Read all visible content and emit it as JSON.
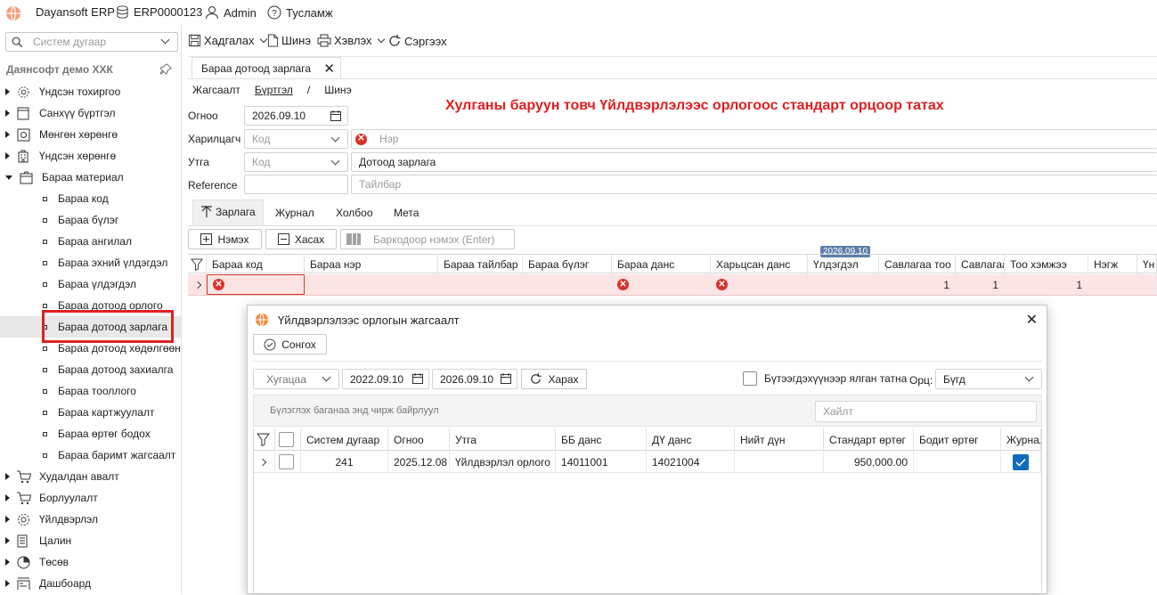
{
  "topbar": {
    "app_name": "Dayansoft ERP",
    "erp_code": "ERP0000123",
    "user": "Admin",
    "help": "Тусламж"
  },
  "toolbar": {
    "save": "Хадгалах",
    "new": "Шинэ",
    "print": "Хэвлэх",
    "refresh": "Сэргээх"
  },
  "sidebar": {
    "search_placeholder": "Систем дугаар",
    "company": "Даянсофт демо ХХК",
    "items": [
      {
        "label": "Үндсэн тохиргоо",
        "icon": "gear-icon"
      },
      {
        "label": "Санхүү бүртгэл",
        "icon": "ledger-icon"
      },
      {
        "label": "Мөнгөн хөрөнгө",
        "icon": "cash-icon"
      },
      {
        "label": "Үндсэн хөрөнгө",
        "icon": "building-icon"
      },
      {
        "label": "Бараа материал",
        "icon": "box-icon"
      }
    ],
    "sub_items": [
      "Бараа код",
      "Бараа бүлэг",
      "Бараа ангилал",
      "Бараа эхний үлдэгдэл",
      "Бараа үлдэгдэл",
      "Бараа дотоод орлого",
      "Бараа дотоод зарлага",
      "Бараа дотоод хөдөлгөөн",
      "Бараа дотоод захиалга",
      "Бараа тооллого",
      "Бараа картжуулалт",
      "Бараа өртөг бодох",
      "Бараа баримт жагсаалт"
    ],
    "bottom_items": [
      {
        "label": "Худалдан авалт",
        "icon": "cart-icon"
      },
      {
        "label": "Борлуулалт",
        "icon": "sales-icon"
      },
      {
        "label": "Үйлдвэрлэл",
        "icon": "factory-icon"
      },
      {
        "label": "Цалин",
        "icon": "payroll-icon"
      },
      {
        "label": "Төсөв",
        "icon": "pie-icon"
      },
      {
        "label": "Дашбоард",
        "icon": "dashboard-icon"
      }
    ]
  },
  "document_tab": {
    "label": "Бараа дотоод зарлага"
  },
  "breadcrumb": {
    "list": "Жагсаалт",
    "register": "Бүртгэл",
    "sep": "/",
    "new": "Шинэ"
  },
  "annotation": "Хулганы баруун товч Үйлдвэрлэлээс орлогоос стандарт орцоор татах",
  "form": {
    "date_label": "Огноо",
    "date_value": "2026.09.10",
    "partner_label": "Харилцагч",
    "partner_code_ph": "Код",
    "partner_name_ph": "Нэр",
    "route_label": "Утга",
    "route_code_ph": "Код",
    "route_value": "Дотоод зарлага",
    "reference_label": "Reference",
    "description_ph": "Тайлбар"
  },
  "subtabs": [
    "Зарлага",
    "Журнал",
    "Холбоо",
    "Мета"
  ],
  "grid_toolbar": {
    "add": "Нэмэх",
    "remove": "Хасах",
    "barcode_ph": "Баркодоор нэмэх (Enter)"
  },
  "grid": {
    "date_badge": "2026.09.10",
    "columns": [
      "Бараа код",
      "Бараа нэр",
      "Бараа тайлбар",
      "Бараа бүлэг",
      "Бараа данс",
      "Харьцсан данс",
      "Үлдэгдэл",
      "Савлагаа тоо",
      "Савлагаа",
      "Тоо хэмжээ",
      "Нэгж",
      "Үн"
    ],
    "row": {
      "qty_pack": "1",
      "pack": "1",
      "qty": "1"
    }
  },
  "dialog": {
    "title": "Үйлдвэрлэлээс орлогын жагсаалт",
    "select_button": "Сонгох",
    "period_ph": "Хугацаа",
    "date_from": "2022.09.10",
    "date_to": "2026.09.10",
    "view_button": "Харах",
    "by_product_label": "Бүтээгдэхүүнээр ялган татна",
    "recipe_label": "Орц:",
    "recipe_value": "Бүгд",
    "group_hint": "Бүлэглэх баганаа энд чирж байрлуул",
    "search_ph": "Хайлт",
    "columns": [
      "Систем дугаар",
      "Огноо",
      "Утга",
      "ББ данс",
      "ДҮ данс",
      "Нийт дүн",
      "Стандарт өртөг",
      "Бодит өртөг",
      "Журнал"
    ],
    "rows": [
      {
        "sys_no": "241",
        "date": "2025.12.08",
        "desc": "Үйлдвэрлэл орлого",
        "bb": "14011001",
        "du": "14021004",
        "total": "",
        "std_cost": "950,000.00",
        "real_cost": "",
        "journal": true
      }
    ]
  },
  "colors": {
    "error": "#d9322b",
    "annotation": "#e02020",
    "highlight_box": "#e02020",
    "accent": "#0f6cbd"
  }
}
